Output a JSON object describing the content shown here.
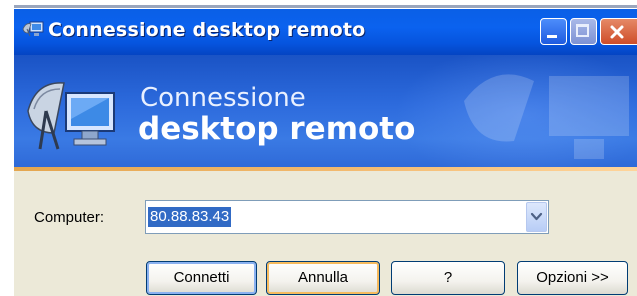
{
  "window": {
    "title": "Connessione desktop remoto",
    "icon": "remote-desktop-icon",
    "controls": [
      "minimize-icon",
      "maximize-icon",
      "close-icon"
    ]
  },
  "banner": {
    "line1": "Connessione",
    "line2": "desktop remoto",
    "logo": "remote-desktop-logo"
  },
  "form": {
    "computer_label": "Computer:",
    "computer_value": "80.88.83.43",
    "dropdown_icon": "chevron-down-icon"
  },
  "buttons": {
    "connect": "Connetti",
    "cancel": "Annulla",
    "help": "?",
    "options": "Opzioni >>"
  },
  "colors": {
    "titlebar": "#0b62ef",
    "banner": "#2d6bdd",
    "accent_rule": "#f2b86c",
    "selection": "#316ac5",
    "dialog_bg": "#ece9d8"
  }
}
